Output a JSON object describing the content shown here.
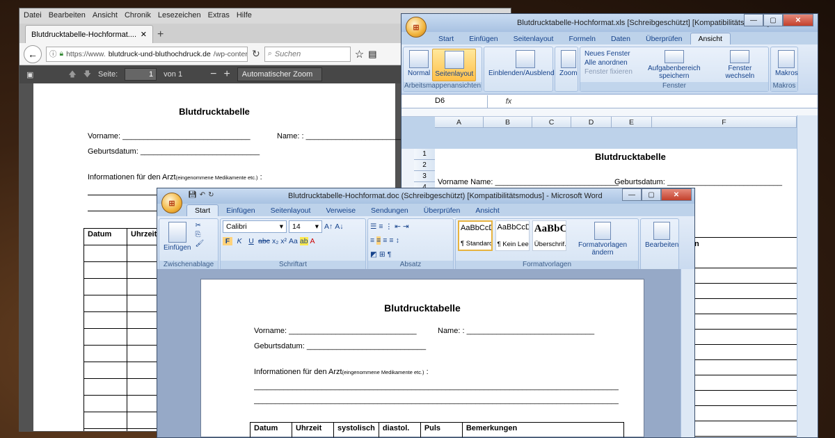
{
  "firefox": {
    "menu": [
      "Datei",
      "Bearbeiten",
      "Ansicht",
      "Chronik",
      "Lesezeichen",
      "Extras",
      "Hilfe"
    ],
    "tab_title": "Blutdrucktabelle-Hochformat....",
    "url_prefix": "https://www.",
    "url_domain": "blutdruck-und-bluthochdruck.de",
    "url_path": "/wp-conter",
    "search_placeholder": "Suchen",
    "pdf": {
      "page_label": "Seite:",
      "page_value": "1",
      "page_of": "von 1",
      "zoom": "Automatischer Zoom",
      "title": "Blutdrucktabelle",
      "vorname": "Vorname: ______________________________",
      "name": "Name: : ____________________________",
      "geburtsdatum": "Geburtsdatum: ____________________________",
      "info": "Informationen für den Arzt",
      "info_small": "(eingenommene Medikamente etc.)",
      "info_colon": " :",
      "table_headers": [
        "Datum",
        "Uhrzeit"
      ]
    }
  },
  "excel": {
    "title": "Blutdrucktabelle-Hochformat.xls [Schreibgeschützt] [Kompatibilitätsmodus] - Mi...",
    "tabs": [
      "Start",
      "Einfügen",
      "Seitenlayout",
      "Formeln",
      "Daten",
      "Überprüfen",
      "Ansicht"
    ],
    "active_tab": "Ansicht",
    "ribbon": {
      "normal": "Normal",
      "seitenlayout": "Seitenlayout",
      "group1": "Arbeitsmappenansichten",
      "einblenden": "Einblenden/Ausblenden",
      "zoom": "Zoom",
      "neues_fenster": "Neues Fenster",
      "alle_anordnen": "Alle anordnen",
      "fenster_fixieren": "Fenster fixieren",
      "aufgabenbereich": "Aufgabenbereich speichern",
      "fenster_wechseln": "Fenster wechseln",
      "group_fenster": "Fenster",
      "makros": "Makros",
      "group_makros": "Makros"
    },
    "name_box": "D6",
    "fx": "fx",
    "columns": [
      "A",
      "B",
      "C",
      "D",
      "E",
      "F"
    ],
    "rows": [
      "1",
      "2",
      "3",
      "4"
    ],
    "cell_title": "Blutdrucktabelle",
    "cell_vorname": "Vorname Name: _____________________________",
    "cell_geburtsdatum": "Geburtsdatum: ___________________________",
    "partial_header": "n"
  },
  "word": {
    "title": "Blutdrucktabelle-Hochformat.doc (Schreibgeschützt) [Kompatibilitätsmodus] - Microsoft Word",
    "tabs": [
      "Start",
      "Einfügen",
      "Seitenlayout",
      "Verweise",
      "Sendungen",
      "Überprüfen",
      "Ansicht"
    ],
    "active_tab": "Start",
    "ribbon": {
      "einfuegen": "Einfügen",
      "zwischenablage": "Zwischenablage",
      "font": "Calibri",
      "size": "14",
      "schriftart": "Schriftart",
      "absatz": "Absatz",
      "formatvorlagen": "Formatvorlagen",
      "formatvorlagen_aendern": "Formatvorlagen ändern",
      "bearbeiten": "Bearbeiten",
      "styles": [
        {
          "preview": "AaBbCcDc",
          "name": "¶ Standard"
        },
        {
          "preview": "AaBbCcDc",
          "name": "¶ Kein Lee..."
        },
        {
          "preview": "AaBbC",
          "name": "Überschrif..."
        }
      ]
    },
    "doc": {
      "title": "Blutdrucktabelle",
      "vorname": "Vorname: ______________________________",
      "name": "Name: : ______________________________",
      "geburtsdatum": "Geburtsdatum: ____________________________",
      "info": "Informationen für den Arzt",
      "info_small": "(eingenommene Medikamente etc.)",
      "info_colon": " :",
      "line": "________________________________________________________________________________________",
      "table_headers": [
        "Datum",
        "Uhrzeit",
        "systolisch",
        "diastol.",
        "Puls",
        "Bemerkungen"
      ]
    }
  }
}
